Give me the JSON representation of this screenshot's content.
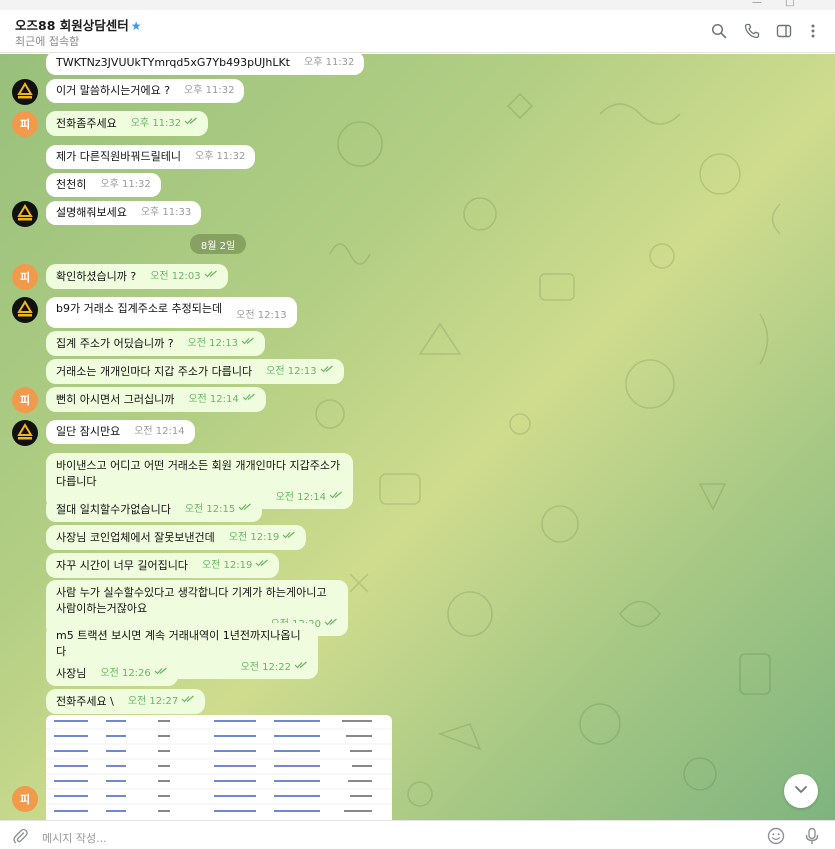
{
  "window": {
    "minimize_glyph": "—",
    "maximize_glyph": "□"
  },
  "header": {
    "title": "오즈88 회원상담센터",
    "verified_glyph": "★",
    "status": "최근에 접속함"
  },
  "icons": {
    "search": "search-icon",
    "call": "phone-icon",
    "sidebar": "sidebar-toggle-icon",
    "more": "more-vertical-icon",
    "attach": "paperclip-icon",
    "emoji": "emoji-icon",
    "mic": "microphone-icon",
    "scroll": "chevron-down-icon"
  },
  "colors": {
    "accent": "#3f97e6",
    "outgoing": "#effdde",
    "incoming": "#ffffff",
    "avatar_user": "#f29a4c",
    "check": "#6ab564"
  },
  "avatar_user_initial": "피",
  "date_separator": "8월 2일",
  "messages": [
    {
      "text": "TWKTNz3JVUUkTYmrqd5xG7Yb493pUJhLKt",
      "time": "오후 11:32"
    },
    {
      "text": "이거 말씀하시는거에요 ?",
      "time": "오후 11:32"
    },
    {
      "text": "전화좀주세요",
      "time": "오후 11:32"
    },
    {
      "text": "제가 다른직원바꿔드릴테니",
      "time": "오후 11:32"
    },
    {
      "text": "천천히",
      "time": "오후 11:32"
    },
    {
      "text": "설명해줘보세요",
      "time": "오후 11:33"
    },
    {
      "text": "확인하셨습니까 ?",
      "time": "오전 12:03"
    },
    {
      "text": "b9가 거래소 집계주소로 추정되는데",
      "time": "오전 12:13"
    },
    {
      "text": "집계 주소가 어딨습니까 ?",
      "time": "오전 12:13"
    },
    {
      "text": "거래소는 개개인마다 지갑 주소가 다릅니다",
      "time": "오전 12:13"
    },
    {
      "text": "뻔히 아시면서 그러십니까",
      "time": "오전 12:14"
    },
    {
      "text": "일단 잠시만요",
      "time": "오전 12:14"
    },
    {
      "text": "바이낸스고 어디고 어떤 거래소든 회원 개개인마다 지갑주소가 다릅니다",
      "time": "오전 12:14"
    },
    {
      "text": "절대 일치할수가없습니다",
      "time": "오전 12:15"
    },
    {
      "text": "사장님 코인업체에서 잘못보낸건데",
      "time": "오전 12:19"
    },
    {
      "text": "자꾸 시간이 너무 길어집니다",
      "time": "오전 12:19"
    },
    {
      "text": "사람 누가 실수할수있다고 생각합니다 기계가 하는게아니고 사람이하는거잖아요",
      "time": "오전 12:20"
    },
    {
      "text": "m5 트랙션 보시면 계속 거래내역이 1년전까지나옵니다",
      "time": "오전 12:22"
    },
    {
      "text": "사장님",
      "time": "오전 12:26"
    },
    {
      "text": "전화주세요 \\",
      "time": "오전 12:27"
    }
  ],
  "footer": {
    "placeholder": "메시지 작성..."
  }
}
